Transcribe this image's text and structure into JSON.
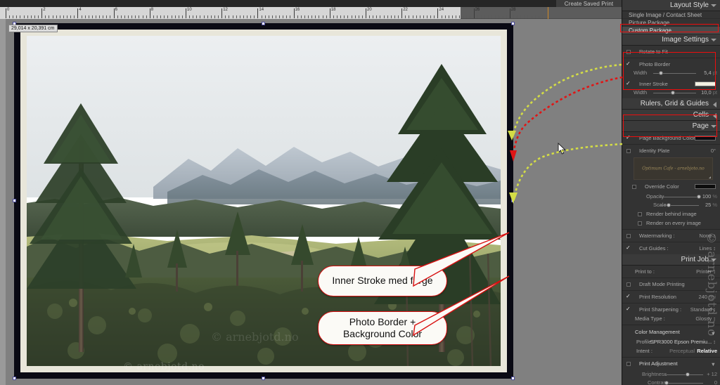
{
  "app": {
    "module": "Print",
    "saved_print_button": "Create Saved Print",
    "watermark": "© arnebjotd.no"
  },
  "ruler": {
    "unit": "cm",
    "ticks": [
      0,
      2,
      4,
      6,
      8,
      10,
      12,
      14,
      16,
      18,
      20,
      22,
      24,
      26,
      28
    ]
  },
  "canvas": {
    "dimension_label": "29,014 x 20,391 cm"
  },
  "callouts": [
    {
      "id": "inner-stroke",
      "text": "Inner Stroke med farge"
    },
    {
      "id": "photo-border",
      "line1": "Photo Border +",
      "line2": "Background Color"
    }
  ],
  "panel": {
    "layout_style": {
      "title": "Layout Style",
      "options": [
        {
          "label": "Single Image / Contact Sheet",
          "selected": false
        },
        {
          "label": "Picture Package",
          "selected": false
        },
        {
          "label": "Custom Package",
          "selected": true
        }
      ]
    },
    "image_settings": {
      "title": "Image Settings",
      "rotate_to_fit": {
        "label": "Rotate to Fit",
        "checked": false
      },
      "photo_border": {
        "label": "Photo Border",
        "checked": true,
        "width_label": "Width",
        "width_value": "5,4",
        "width_unit": "pt",
        "width_pct": 18
      },
      "inner_stroke": {
        "label": "Inner Stroke",
        "checked": true,
        "color": "#f2f0e2",
        "width_label": "Width",
        "width_value": "10,0",
        "width_unit": "pt",
        "width_pct": 46
      }
    },
    "rulers_grid_guides": {
      "title": "Rulers, Grid & Guides"
    },
    "cells": {
      "title": "Cells"
    },
    "page": {
      "title": "Page",
      "page_background_color": {
        "label": "Page Background Color",
        "checked": true,
        "color": "#0b0b10"
      },
      "identity_plate": {
        "label": "Identity Plate",
        "checked": false,
        "angle": "0°",
        "preview_text": "Optimum Cafe - arnebjoto.no",
        "override_color": {
          "label": "Override Color",
          "checked": false,
          "color": "#0d0d0d"
        },
        "opacity": {
          "label": "Opacity",
          "value": "100",
          "unit": "%",
          "pct": 100
        },
        "scale": {
          "label": "Scale",
          "value": "25",
          "unit": "%",
          "pct": 25
        },
        "render_behind_image": {
          "label": "Render behind image",
          "checked": false
        },
        "render_on_every_image": {
          "label": "Render on every image",
          "checked": false
        }
      },
      "watermarking": {
        "label": "Watermarking :",
        "checked": false,
        "value": "None"
      },
      "cut_guides": {
        "label": "Cut Guides :",
        "checked": true,
        "value": "Lines"
      }
    },
    "print_job": {
      "title": "Print Job",
      "print_to": {
        "label": "Print to :",
        "value": "Printer"
      },
      "draft_mode_printing": {
        "label": "Draft Mode Printing",
        "checked": false
      },
      "print_resolution": {
        "label": "Print Resolution",
        "checked": true,
        "value": "240",
        "unit": "ppi"
      },
      "print_sharpening": {
        "label": "Print Sharpening :",
        "checked": true,
        "value": "Standard"
      },
      "media_type": {
        "label": "Media Type :",
        "value": "Glossy"
      },
      "color_management": {
        "title": "Color Management",
        "profile": {
          "label": "Profile :",
          "value": "SPR3000 Epson Premiu..."
        },
        "intent": {
          "label": "Intent :",
          "option_a": "Perceptual",
          "option_b": "Relative",
          "selected": "Relative"
        }
      },
      "print_adjustment": {
        "title": "Print Adjustment",
        "checked": false,
        "brightness": {
          "label": "Brightness",
          "value": "+ 12",
          "pct": 60
        },
        "contrast": {
          "label": "Contrast",
          "value": "0",
          "pct": 6
        }
      }
    }
  },
  "colors": {
    "accent_red": "#ee0d0d",
    "panel_bg": "#2c2c2c",
    "canvas_bg": "#808080",
    "selection_blue": "#5b5bbf",
    "guide_yellow": "#d8e04a"
  }
}
